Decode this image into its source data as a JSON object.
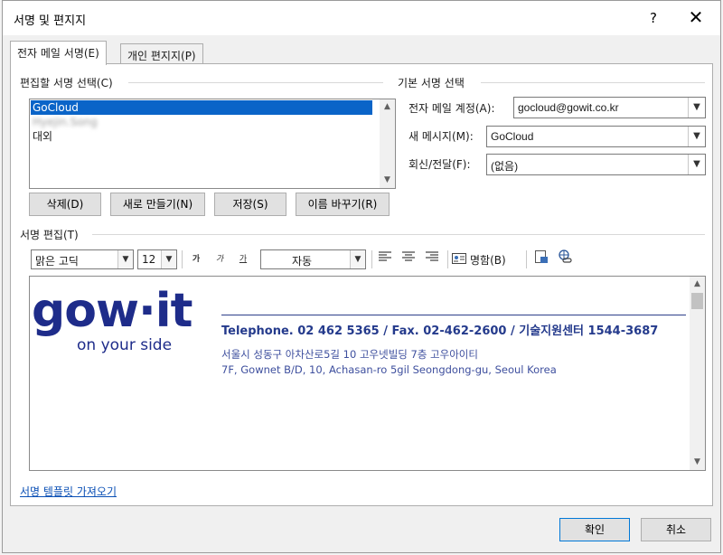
{
  "window": {
    "title": "서명 및 편지지",
    "help_label": "?",
    "close_label": "✕"
  },
  "tabs": [
    {
      "label": "전자 메일 서명(E)",
      "active": true
    },
    {
      "label": "개인 편지지(P)",
      "active": false
    }
  ],
  "select_signature": {
    "group_label": "편집할 서명 선택(C)",
    "items": [
      {
        "label": "GoCloud",
        "selected": true
      },
      {
        "label": "Hyejin.Song",
        "blurred": true
      },
      {
        "label": "대외"
      }
    ]
  },
  "signature_buttons": {
    "delete": "삭제(D)",
    "new": "새로 만들기(N)",
    "save": "저장(S)",
    "rename": "이름 바꾸기(R)"
  },
  "default_signature": {
    "group_label": "기본 서명 선택",
    "account_label": "전자 메일 계정(A):",
    "account_value": "gocloud@gowit.co.kr",
    "new_messages_label": "새 메시지(M):",
    "new_messages_value": "GoCloud",
    "replies_label": "회신/전달(F):",
    "replies_value": "(없음)"
  },
  "edit_signature": {
    "group_label": "서명 편집(T)",
    "font_value": "맑은 고딕",
    "size_value": "12",
    "bold_label": "가",
    "italic_label": "가",
    "underline_label": "가",
    "color_value": "자동",
    "business_card_label": "명함(B)",
    "icons": [
      "align-left-icon",
      "align-center-icon",
      "align-right-icon",
      "business-card-icon",
      "insert-picture-icon",
      "insert-hyperlink-icon"
    ]
  },
  "signature_content": {
    "logo_text": "gow·it",
    "logo_tagline": "on your side",
    "phone_line": "Telephone. 02 462 5365 / Fax. 02-462-2600 / 기술지원센터 1544-3687",
    "address_ko": "서울시 성동구 아차산로5길 10 고우넷빌딩 7층 고우아이티",
    "address_en": "7F, Gownet B/D, 10, Achasan-ro 5gil Seongdong-gu, Seoul Korea",
    "brand_color": "#1e2c8a"
  },
  "template_link": "서명 템플릿 가져오기",
  "footer": {
    "ok_label": "확인",
    "cancel_label": "취소"
  }
}
